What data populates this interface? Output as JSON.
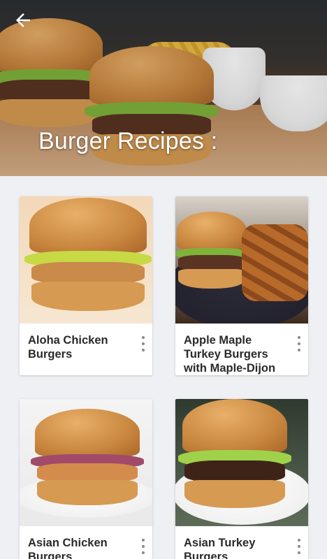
{
  "header": {
    "title": "Burger Recipes :",
    "back_icon": "arrow-left-icon"
  },
  "recipes": [
    {
      "title": "Aloha Chicken Burgers",
      "menu_icon": "more-vert-icon"
    },
    {
      "title": "Apple Maple Turkey Burgers with Maple-Dijon Sauce",
      "menu_icon": "more-vert-icon"
    },
    {
      "title": "Asian Chicken Burgers",
      "menu_icon": "more-vert-icon"
    },
    {
      "title": "Asian Turkey Burgers",
      "menu_icon": "more-vert-icon"
    }
  ],
  "colors": {
    "background": "#eef0f3",
    "card": "#ffffff",
    "title_text": "#2a2a2a",
    "hero_title": "#ffffff"
  }
}
